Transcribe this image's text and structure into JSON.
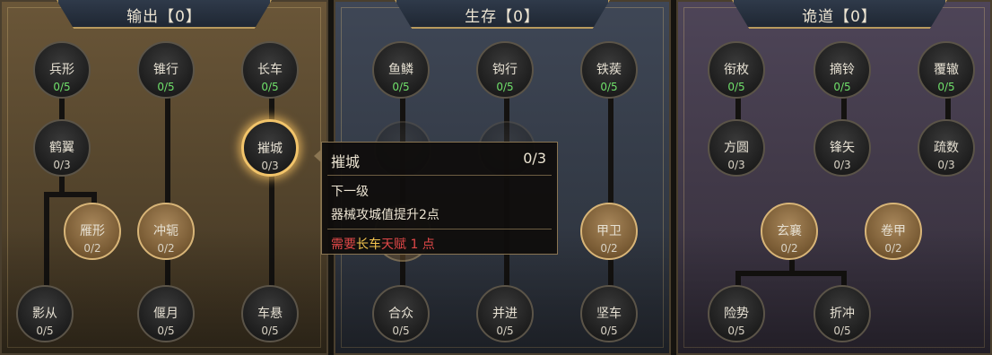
{
  "panels": [
    {
      "title": "输出【0】"
    },
    {
      "title": "生存【0】"
    },
    {
      "title": "诡道【0】"
    }
  ],
  "nodes": {
    "p0": [
      {
        "name": "兵形",
        "count": "0/5"
      },
      {
        "name": "锥行",
        "count": "0/5"
      },
      {
        "name": "长车",
        "count": "0/5"
      },
      {
        "name": "鹤翼",
        "count": "0/3"
      },
      {
        "name": "摧城",
        "count": "0/3"
      },
      {
        "name": "雁形",
        "count": "0/2"
      },
      {
        "name": "冲轭",
        "count": "0/2"
      },
      {
        "name": "影从",
        "count": "0/5"
      },
      {
        "name": "偃月",
        "count": "0/5"
      },
      {
        "name": "车悬",
        "count": "0/5"
      }
    ],
    "p1": [
      {
        "name": "鱼鳞",
        "count": "0/5"
      },
      {
        "name": "钩行",
        "count": "0/5"
      },
      {
        "name": "铁蒺",
        "count": "0/5"
      },
      {
        "name": "甲卫",
        "count": "0/2"
      },
      {
        "name": "合众",
        "count": "0/5"
      },
      {
        "name": "并进",
        "count": "0/5"
      },
      {
        "name": "坚车",
        "count": "0/5"
      }
    ],
    "p2": [
      {
        "name": "衔枚",
        "count": "0/5"
      },
      {
        "name": "摘铃",
        "count": "0/5"
      },
      {
        "name": "覆辙",
        "count": "0/5"
      },
      {
        "name": "方圆",
        "count": "0/3"
      },
      {
        "name": "锋矢",
        "count": "0/3"
      },
      {
        "name": "疏数",
        "count": "0/3"
      },
      {
        "name": "玄襄",
        "count": "0/2"
      },
      {
        "name": "卷甲",
        "count": "0/2"
      },
      {
        "name": "险势",
        "count": "0/5"
      },
      {
        "name": "折冲",
        "count": "0/5"
      }
    ]
  },
  "tooltip": {
    "name": "摧城",
    "count": "0/3",
    "next_level": "下一级",
    "desc": "器械攻城值提升2点",
    "req_prefix": "需要",
    "req_talent": "长车",
    "req_mid": "天赋",
    "req_points": " 1 点"
  },
  "colors": {
    "green_count": "#6fe06a",
    "selected_glow": "#f2c46a",
    "requirement_red": "#e04848",
    "requirement_gold": "#f3c44e"
  }
}
